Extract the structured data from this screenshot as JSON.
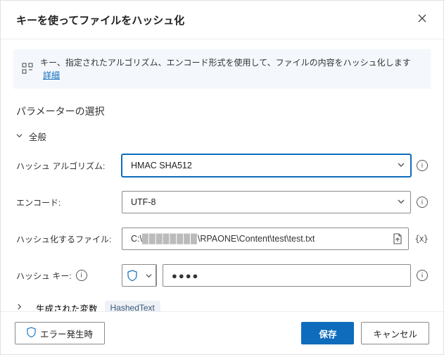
{
  "header": {
    "title": "キーを使ってファイルをハッシュ化"
  },
  "info": {
    "text": "キー、指定されたアルゴリズム、エンコード形式を使用して、ファイルの内容をハッシュ化します",
    "link": "詳細"
  },
  "section_title": "パラメーターの選択",
  "group_general": "全般",
  "labels": {
    "algorithm": "ハッシュ アルゴリズム:",
    "encoding": "エンコード:",
    "file": "ハッシュ化するファイル:",
    "key": "ハッシュ キー:"
  },
  "values": {
    "algorithm": "HMAC SHA512",
    "encoding": "UTF-8",
    "file_prefix": "C:\\",
    "file_suffix": "\\RPAONE\\Content\\test\\test.txt",
    "key_mask": "●●●●"
  },
  "generated": {
    "label": "生成された変数",
    "var": "HashedText"
  },
  "footer": {
    "error": "エラー発生時",
    "save": "保存",
    "cancel": "キャンセル"
  }
}
